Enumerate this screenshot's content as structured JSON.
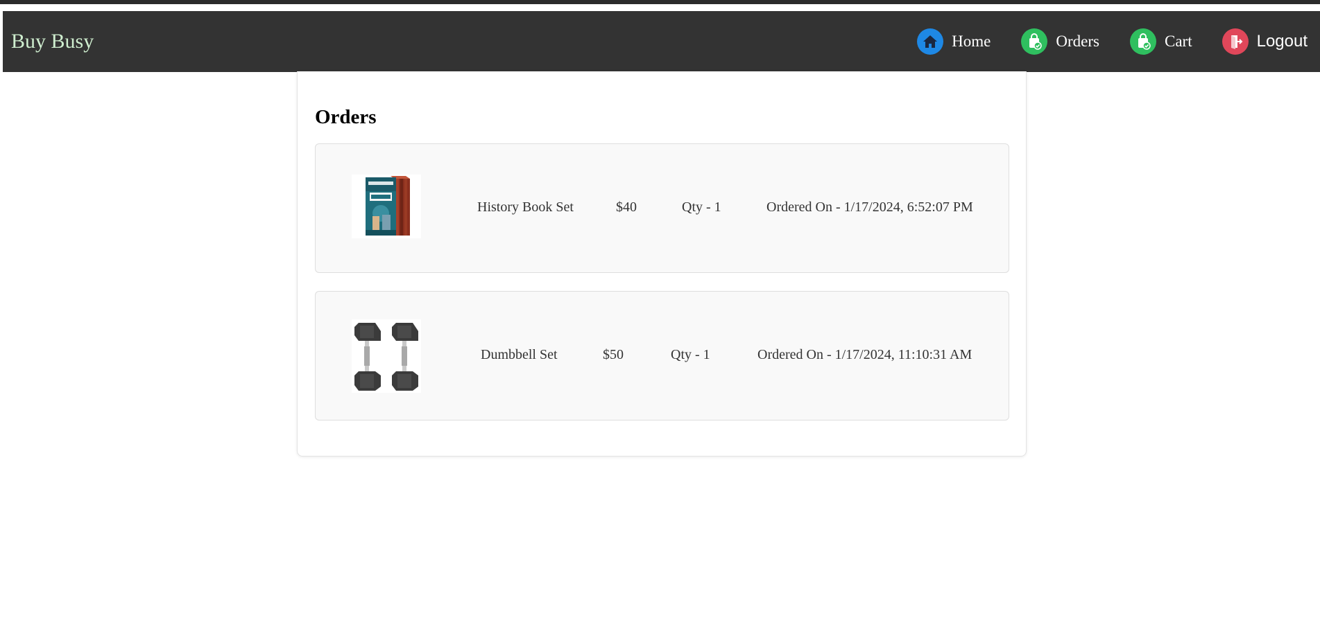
{
  "brand": "Buy Busy",
  "nav": {
    "home": {
      "label": "Home",
      "icon": "home-icon",
      "color": "#1e88e5"
    },
    "orders": {
      "label": "Orders",
      "icon": "shopping-bag-check-icon",
      "color": "#2fbf5f"
    },
    "cart": {
      "label": "Cart",
      "icon": "shopping-bag-check-icon",
      "color": "#2fbf5f"
    },
    "logout": {
      "label": "Logout",
      "icon": "logout-door-icon",
      "color": "#e0475a"
    }
  },
  "page": {
    "title": "Orders"
  },
  "orders": [
    {
      "name": "History Book Set",
      "price": "$40",
      "qty": "Qty - 1",
      "ordered_on": "Ordered On - 1/17/2024, 6:52:07 PM",
      "image": "encyclopedia-history-book-set"
    },
    {
      "name": "Dumbbell Set",
      "price": "$50",
      "qty": "Qty - 1",
      "ordered_on": "Ordered On - 1/17/2024, 11:10:31 AM",
      "image": "hex-dumbbell-pair"
    }
  ]
}
